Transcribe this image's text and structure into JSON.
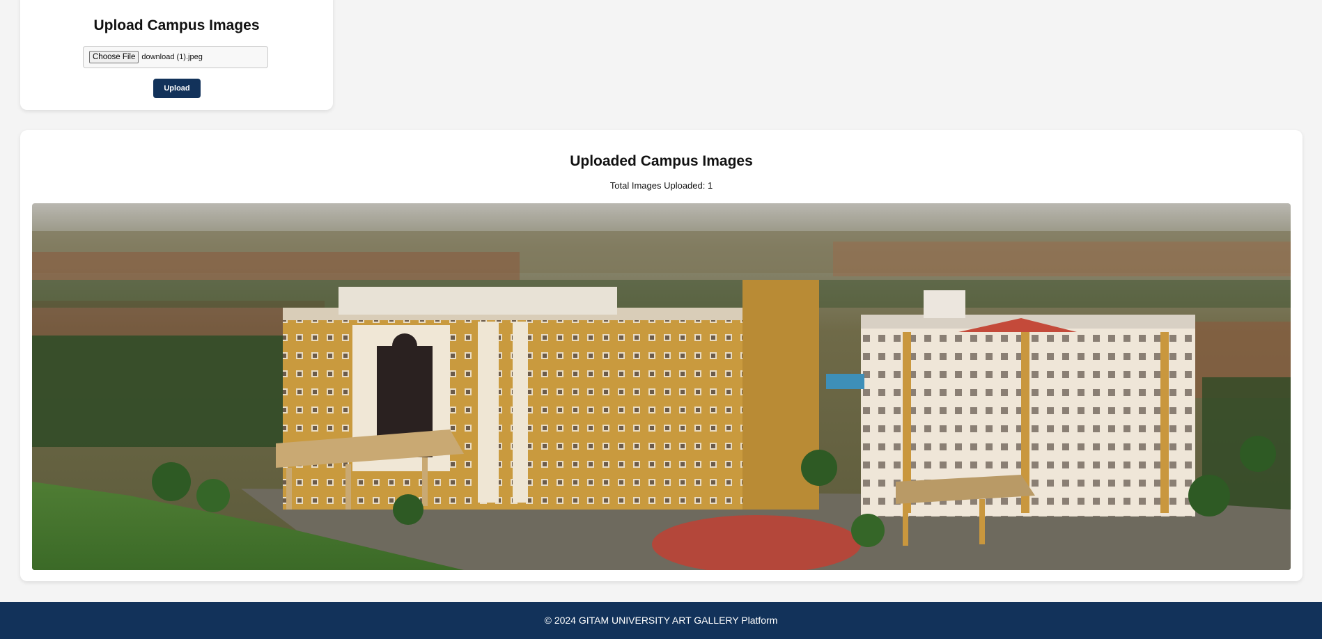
{
  "upload": {
    "title": "Upload Campus Images",
    "choose_file_label": "Choose File",
    "selected_file": "download (1).jpeg",
    "upload_label": "Upload"
  },
  "gallery": {
    "title": "Uploaded Campus Images",
    "total_label": "Total Images Uploaded: 1",
    "images": [
      {
        "alt": "campus-photo"
      }
    ]
  },
  "footer": {
    "text": "© 2024 GITAM UNIVERSITY ART GALLERY Platform"
  },
  "colors": {
    "brand": "#12325a",
    "background": "#f4f4f4",
    "card": "#ffffff"
  }
}
